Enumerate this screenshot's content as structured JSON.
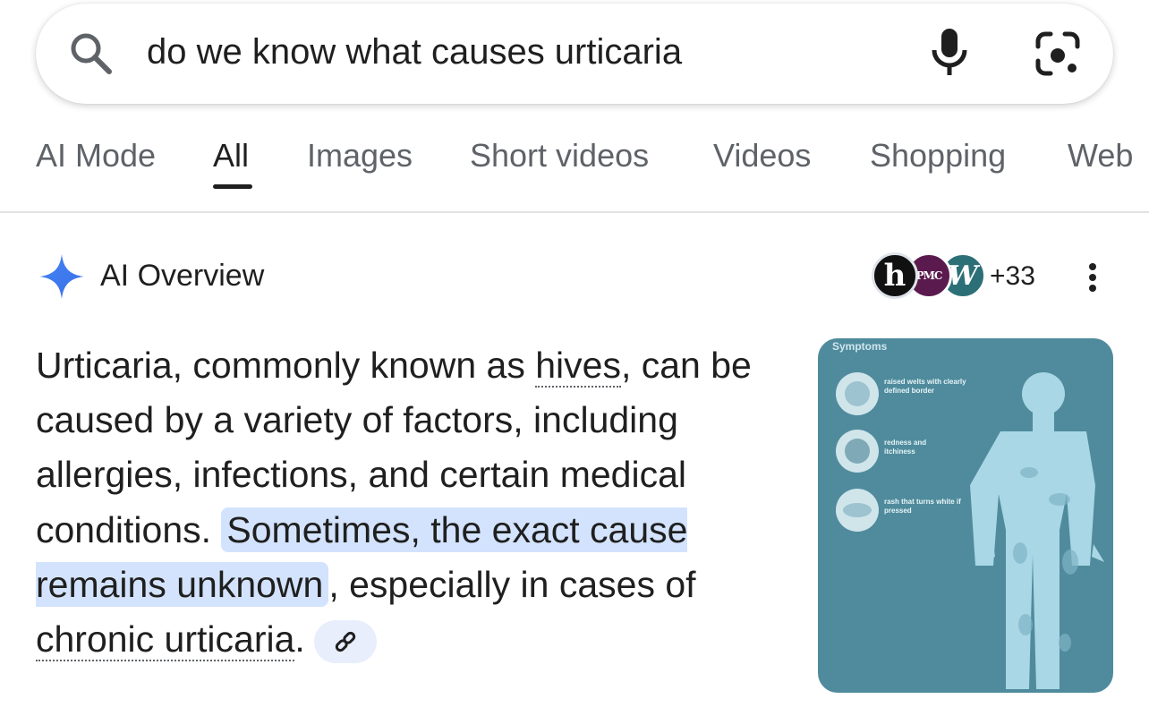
{
  "search": {
    "query": "do we know what causes urticaria",
    "search_icon": "search-icon",
    "mic_icon": "microphone-icon",
    "lens_icon": "camera-lens-icon"
  },
  "tabs": [
    {
      "label": "AI Mode",
      "active": false
    },
    {
      "label": "All",
      "active": true
    },
    {
      "label": "Images",
      "active": false
    },
    {
      "label": "Short videos",
      "active": false
    },
    {
      "label": "Videos",
      "active": false
    },
    {
      "label": "Shopping",
      "active": false
    },
    {
      "label": "Web",
      "active": false
    }
  ],
  "ai_overview": {
    "title": "AI Overview",
    "icon": "sparkle-icon",
    "sources": {
      "avatars": [
        "h",
        "PMC",
        "W"
      ],
      "more_count": "+33"
    },
    "text": {
      "part1": "Urticaria, commonly known as ",
      "link1": "hives",
      "part2": ", can be caused by a variety of factors, includ­ing allergies, infections, and certain med­ical conditions. ",
      "highlight": "Sometimes, the exact cause remains unknown",
      "part3": ", especially in cases of ",
      "link2": "chronic urticaria",
      "part4": "."
    },
    "image": {
      "caption": "Symptoms",
      "labels": [
        "raised welts with clearly defined border",
        "redness and itchiness",
        "rash that turns white if pressed"
      ],
      "background": "#4f8b9c"
    }
  },
  "colors": {
    "accent_blue": "#4285f4",
    "highlight": "#d3e3fd",
    "tab_inactive": "#5f6368"
  }
}
